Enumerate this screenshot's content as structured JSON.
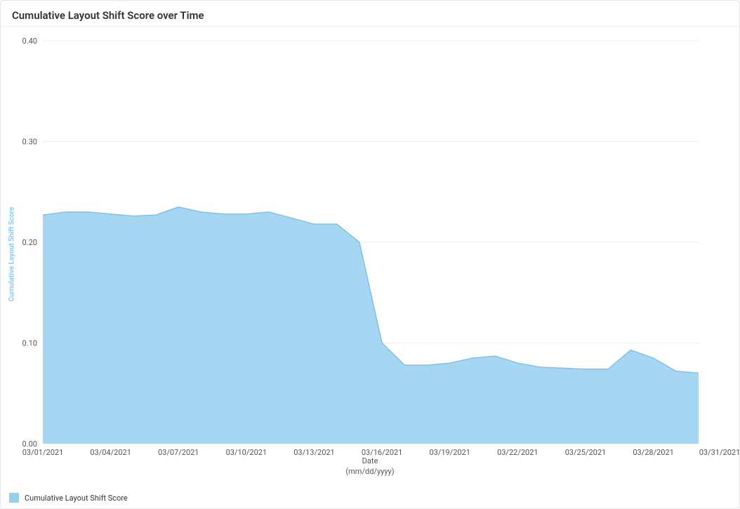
{
  "chart_data": {
    "type": "area",
    "title": "Cumulative Layout Shift Score over Time",
    "xlabel": "Date",
    "xformat": "(mm/dd/yyyy)",
    "ylabel": "Cumulative Layout Shift Score",
    "ylim": [
      0,
      0.4
    ],
    "y_ticks": [
      0.0,
      0.1,
      0.2,
      0.3,
      0.4
    ],
    "x_tick_labels": [
      "03/01/2021",
      "03/04/2021",
      "03/07/2021",
      "03/10/2021",
      "03/13/2021",
      "03/16/2021",
      "03/19/2021",
      "03/22/2021",
      "03/25/2021",
      "03/28/2021",
      "03/31/2021"
    ],
    "x": [
      "03/01/2021",
      "03/02/2021",
      "03/03/2021",
      "03/04/2021",
      "03/05/2021",
      "03/06/2021",
      "03/07/2021",
      "03/08/2021",
      "03/09/2021",
      "03/10/2021",
      "03/11/2021",
      "03/12/2021",
      "03/13/2021",
      "03/14/2021",
      "03/15/2021",
      "03/16/2021",
      "03/17/2021",
      "03/18/2021",
      "03/19/2021",
      "03/20/2021",
      "03/21/2021",
      "03/22/2021",
      "03/23/2021",
      "03/24/2021",
      "03/25/2021",
      "03/26/2021",
      "03/27/2021",
      "03/28/2021",
      "03/29/2021",
      "03/30/2021"
    ],
    "series": [
      {
        "name": "Cumulative Layout Shift Score",
        "values": [
          0.227,
          0.23,
          0.23,
          0.228,
          0.226,
          0.227,
          0.235,
          0.23,
          0.228,
          0.228,
          0.23,
          0.224,
          0.218,
          0.218,
          0.2,
          0.1,
          0.078,
          0.078,
          0.08,
          0.085,
          0.087,
          0.08,
          0.076,
          0.075,
          0.074,
          0.074,
          0.093,
          0.085,
          0.072,
          0.07
        ]
      }
    ],
    "colors": {
      "fill": "#97cfee",
      "stroke": "#7fc1e8",
      "grid": "#eeeeee",
      "tick": "#555555"
    }
  }
}
